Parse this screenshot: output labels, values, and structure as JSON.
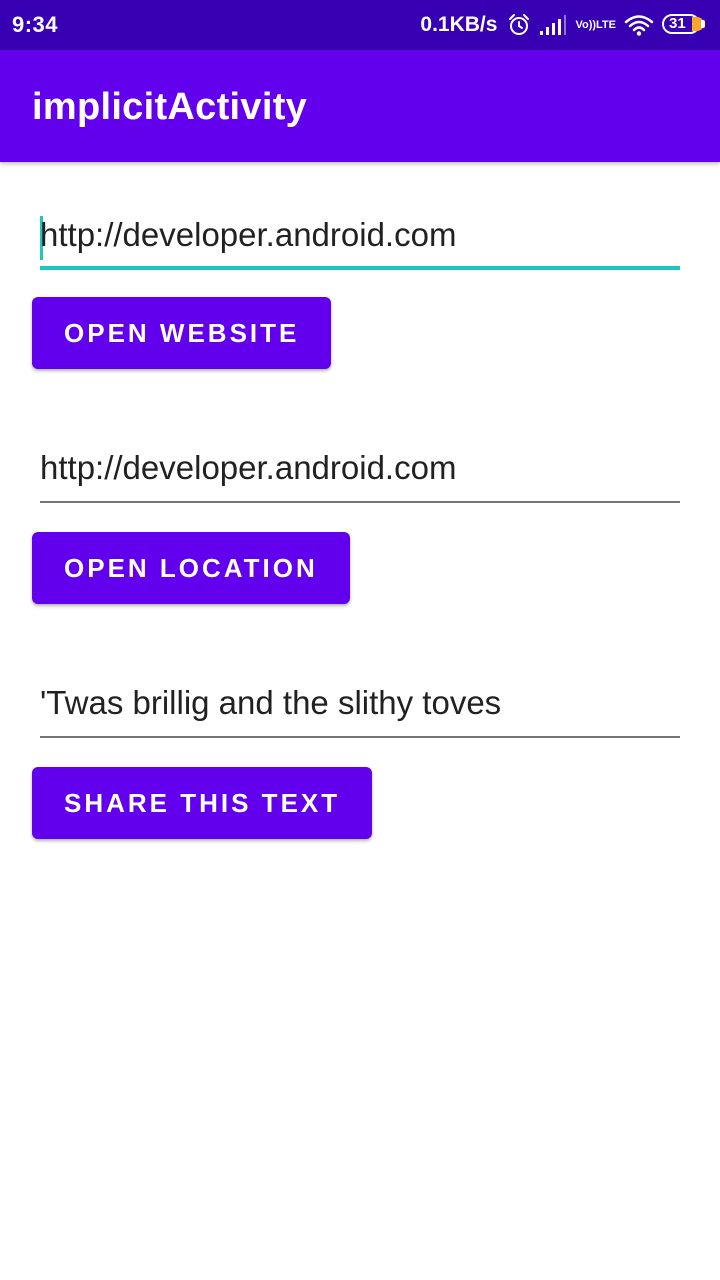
{
  "status_bar": {
    "time": "9:34",
    "net_speed": "0.1KB/s",
    "volte_top": "Vo))",
    "volte_bottom": "LTE",
    "battery_level": "31",
    "icons": [
      "alarm-icon",
      "signal-icon",
      "volte-icon",
      "wifi-icon",
      "battery-icon"
    ]
  },
  "app_bar": {
    "title": "implicitActivity"
  },
  "website": {
    "input_value": "http://developer.android.com",
    "button_label": "OPEN WEBSITE"
  },
  "location": {
    "input_value": "http://developer.android.com",
    "button_label": "OPEN LOCATION"
  },
  "share": {
    "input_value": "'Twas brillig and the slithy toves",
    "button_label": "SHARE THIS TEXT"
  },
  "colors": {
    "status_bar": "#3700B3",
    "primary": "#6200EE",
    "accent": "#1EC8B8"
  }
}
